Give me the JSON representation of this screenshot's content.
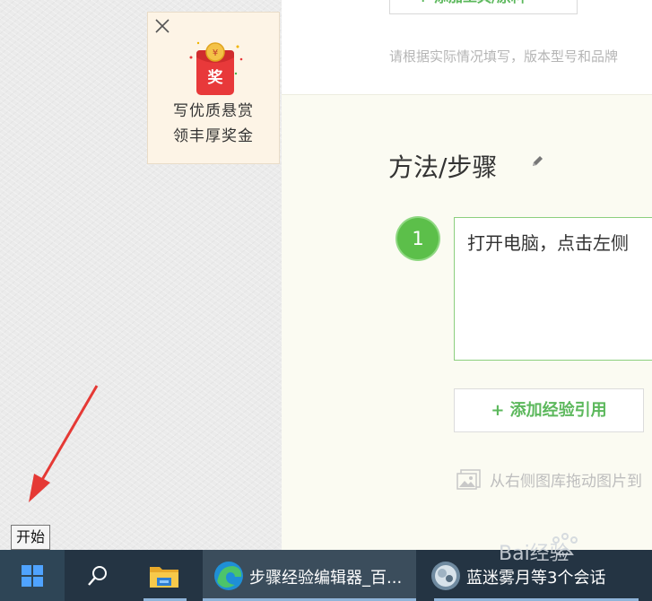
{
  "reward_card": {
    "badge_char": "奖",
    "line1": "写优质悬赏",
    "line2": "领丰厚奖金",
    "close_icon": "close-icon"
  },
  "editor": {
    "add_tool_button": "+ 添加工具/原料",
    "hint": "请根据实际情况填写，版本型号和品牌",
    "section_title": "方法/步骤",
    "step": {
      "number": "1",
      "text": "打开电脑，点击左侧"
    },
    "add_reference_button": "+ 添加经验引用",
    "image_hint": "从右侧图库拖动图片到"
  },
  "tooltip": {
    "start": "开始"
  },
  "taskbar": {
    "items": [
      {
        "icon": "windows-start-icon"
      },
      {
        "icon": "search-icon"
      },
      {
        "icon": "file-explorer-icon"
      },
      {
        "icon": "edge-icon",
        "label": "步骤经验编辑器_百..."
      },
      {
        "icon": "chat-avatar-icon",
        "label": "蓝迷雾月等3个会话"
      }
    ]
  },
  "watermark": {
    "text": "Bai经验"
  },
  "colors": {
    "accent_green": "#5cbf4a",
    "taskbar": "#243443",
    "reward_bg": "#fdf4e6",
    "red_envelope": "#e8393a"
  }
}
